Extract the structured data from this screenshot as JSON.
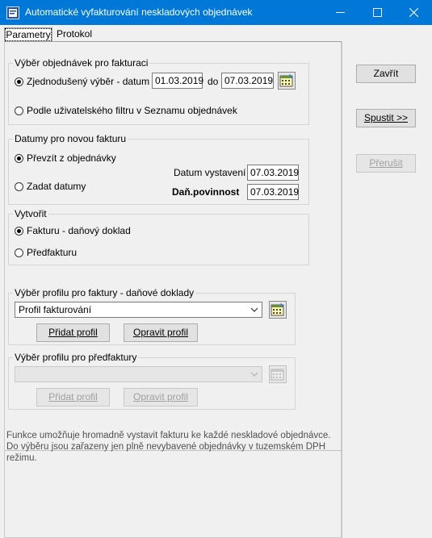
{
  "window": {
    "title": "Automatické vyfakturování neskladových objednávek",
    "minimize": "—",
    "maximize": "☐",
    "close": "✕"
  },
  "tabs": [
    {
      "label": "Parametry",
      "active": true
    },
    {
      "label": "Protokol",
      "active": false
    }
  ],
  "group_selection": {
    "title": "Výběr objednávek pro fakturaci",
    "opt_simple": {
      "label": "Zjednodušený výběr - datum od",
      "checked": true
    },
    "date_from": "01.03.2019",
    "to_label": "do",
    "date_to": "07.03.2019",
    "opt_filter": {
      "label": "Podle uživatelského filtru v Seznamu objednávek",
      "checked": false
    }
  },
  "group_dates": {
    "title": "Datumy pro novou fakturu",
    "opt_take": {
      "label": "Převzít z objednávky",
      "checked": true
    },
    "opt_enter": {
      "label": "Zadat datumy",
      "checked": false
    },
    "issue_label": "Datum vystavení",
    "issue_value": "07.03.2019",
    "tax_label": "Daň.povinnost",
    "tax_value": "07.03.2019"
  },
  "group_create": {
    "title": "Vytvořit",
    "opt_invoice": {
      "label": "Fakturu - daňový doklad",
      "checked": true
    },
    "opt_proforma": {
      "label": "Předfakturu",
      "checked": false
    }
  },
  "group_profile_invoice": {
    "title": "Výběr profilu pro faktury - daňové doklady",
    "combo_value": "Profil fakturování",
    "add_label": "Přidat profil",
    "edit_label": "Opravit profil"
  },
  "group_profile_proforma": {
    "title": "Výběr profilu pro předfaktury",
    "combo_value": "",
    "add_label": "Přidat profil",
    "edit_label": "Opravit profil"
  },
  "description": "Funkce umožňuje hromadně vystavit fakturu ke každé neskladové objednávce. Do výběru jsou zařazeny jen plně nevybavené objednávky v tuzemském DPH režimu.",
  "actions": {
    "close_label": "Zavřít",
    "run_label": "Spustit >>",
    "interrupt_label": "Přerušit"
  }
}
